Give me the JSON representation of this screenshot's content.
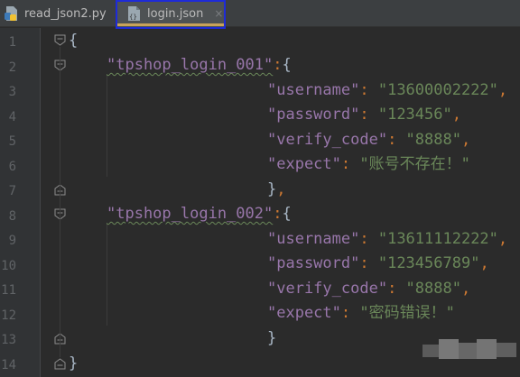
{
  "tabs": [
    {
      "label": "read_json2.py",
      "close": "×",
      "icon": "python-file-icon"
    },
    {
      "label": "login.json",
      "close": "×",
      "icon": "json-file-icon",
      "active": true
    }
  ],
  "line_numbers": [
    "1",
    "2",
    "3",
    "4",
    "5",
    "6",
    "7",
    "8",
    "9",
    "10",
    "11",
    "12",
    "13",
    "14"
  ],
  "code": {
    "open_brace": "{",
    "close_brace": "}",
    "entries": [
      {
        "name": "\"tpshop_login_001\"",
        "colon": ":",
        "open": "{",
        "fields": [
          {
            "key": "\"username\"",
            "sep": ": ",
            "value": "\"13600002222\"",
            "comma": ","
          },
          {
            "key": "\"password\"",
            "sep": ": ",
            "value": "\"123456\"",
            "comma": ","
          },
          {
            "key": "\"verify_code\"",
            "sep": ": ",
            "value": "\"8888\"",
            "comma": ","
          },
          {
            "key": "\"expect\"",
            "sep": ": ",
            "value": "\"账号不存在！\"",
            "comma": ""
          }
        ],
        "close": "}",
        "close_comma": ","
      },
      {
        "name": "\"tpshop_login_002\"",
        "colon": ":",
        "open": "{",
        "fields": [
          {
            "key": "\"username\"",
            "sep": ": ",
            "value": "\"13611112222\"",
            "comma": ","
          },
          {
            "key": "\"password\"",
            "sep": ": ",
            "value": "\"123456789\"",
            "comma": ","
          },
          {
            "key": "\"verify_code\"",
            "sep": ": ",
            "value": "\"8888\"",
            "comma": ","
          },
          {
            "key": "\"expect\"",
            "sep": ": ",
            "value": "\"密码错误！\"",
            "comma": ""
          }
        ],
        "close": "}",
        "close_comma": ""
      }
    ]
  },
  "colors": {
    "key": "#9876aa",
    "string": "#6a8759",
    "punctuation": "#cc7832",
    "background": "#2b2b2b",
    "tab_highlight": "#1e2bd8"
  }
}
